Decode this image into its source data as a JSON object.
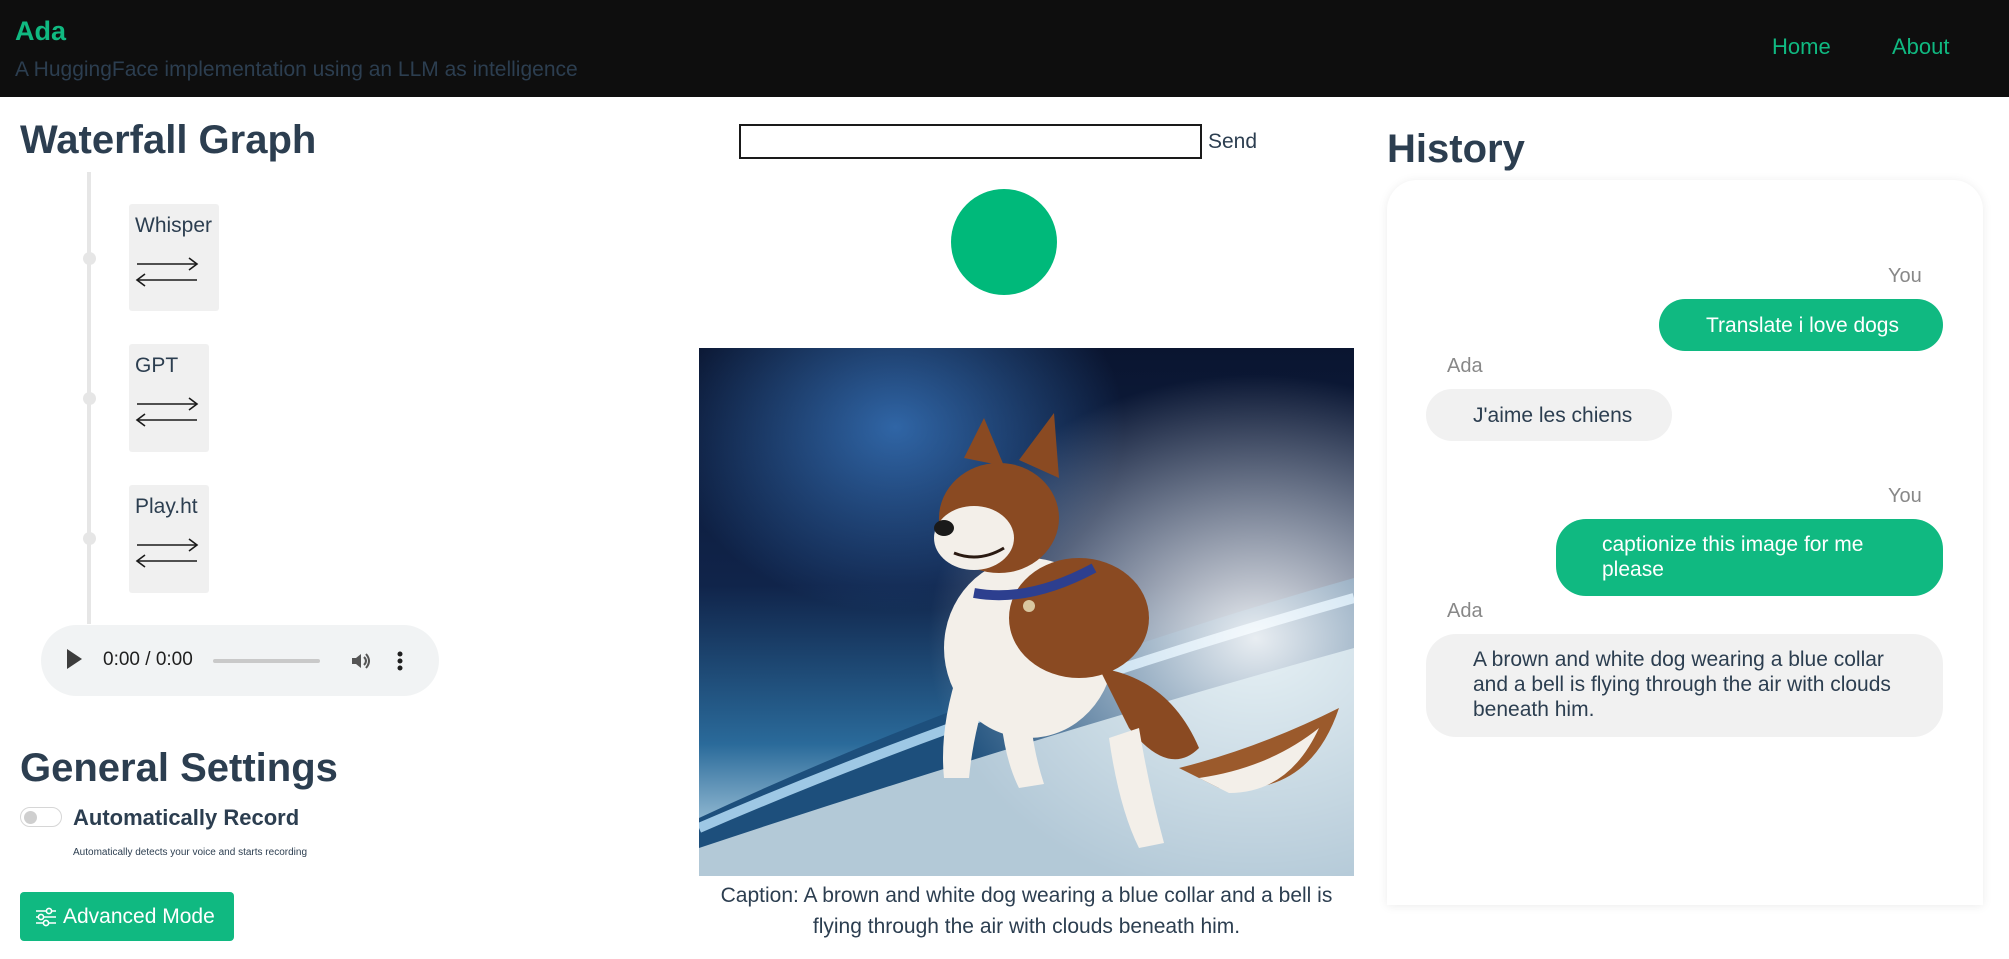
{
  "header": {
    "brand": "Ada",
    "tagline": "A HuggingFace implementation using an LLM as intelligence",
    "nav": [
      "Home",
      "About"
    ]
  },
  "waterfall": {
    "title": "Waterfall Graph",
    "nodes": [
      {
        "label": "Whisper",
        "icon": "bidirectional-arrows-icon"
      },
      {
        "label": "GPT",
        "icon": "bidirectional-arrows-icon"
      },
      {
        "label": "Play.ht",
        "icon": "bidirectional-arrows-icon"
      }
    ]
  },
  "audio": {
    "time": "0:00 / 0:00",
    "progress": 0
  },
  "settings": {
    "title": "General Settings",
    "auto_record_label": "Automatically Record",
    "auto_record_help": "Automatically detects your voice and starts recording",
    "auto_record_enabled": false,
    "advanced_button": "Advanced Mode"
  },
  "input": {
    "value": "",
    "send_label": "Send"
  },
  "main": {
    "record_color": "#00b97a",
    "caption": "Caption: A brown and white dog wearing a blue collar and a bell is flying through the air with clouds beneath him."
  },
  "history": {
    "title": "History",
    "messages": [
      {
        "from": "You",
        "text": "Translate i love dogs"
      },
      {
        "from": "Ada",
        "text": "J'aime les chiens"
      },
      {
        "from": "You",
        "text": "captionize this image for me please"
      },
      {
        "from": "Ada",
        "text": "A brown and white dog wearing a blue collar and a bell is flying through the air with clouds beneath him."
      }
    ]
  },
  "colors": {
    "accent": "#10b981",
    "header_bg": "#0e0e0e",
    "text": "#2c3e50"
  }
}
